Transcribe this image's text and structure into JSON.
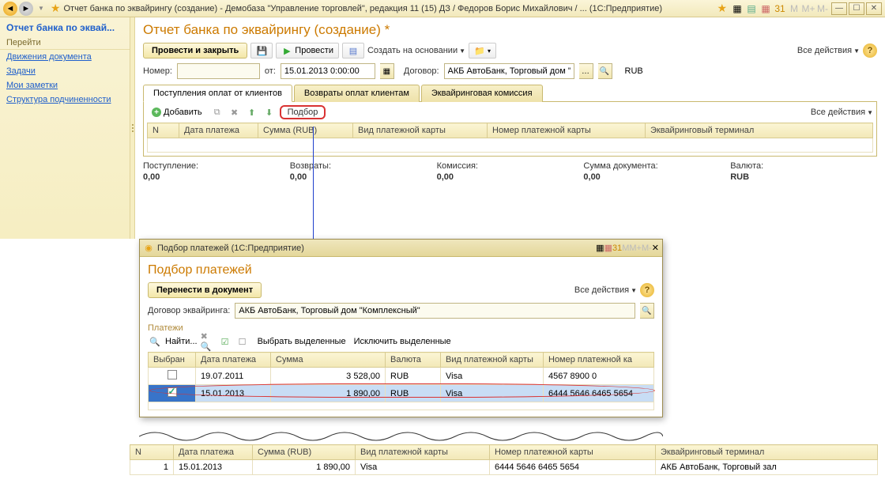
{
  "titlebar": {
    "text": "Отчет банка по эквайрингу (создание) - Демобаза \"Управление торговлей\", редакция 11 (15) ДЗ / Федоров Борис Михайлович / ...   (1С:Предприятие)",
    "m_labels": [
      "M",
      "M+",
      "M-"
    ]
  },
  "sidebar": {
    "title": "Отчет банка по эквай...",
    "section": "Перейти",
    "links": [
      "Движения документа",
      "Задачи",
      "Мои заметки",
      "Структура подчиненности"
    ]
  },
  "form": {
    "title": "Отчет банка по эквайрингу (создание) *",
    "btn_post_close": "Провести и закрыть",
    "btn_post": "Провести",
    "btn_basedon": "Создать на основании",
    "all_actions": "Все действия",
    "lbl_number": "Номер:",
    "number": "",
    "lbl_date": "от:",
    "date": "15.01.2013 0:00:00",
    "lbl_contract": "Договор:",
    "contract": "АКБ АвтоБанк, Торговый дом \"К",
    "currency": "RUB",
    "tabs": [
      "Поступления оплат от клиентов",
      "Возвраты оплат клиентам",
      "Эквайринговая комиссия"
    ],
    "add": "Добавить",
    "podbor": "Подбор",
    "grid_headers": [
      "N",
      "Дата платежа",
      "Сумма (RUB)",
      "Вид платежной карты",
      "Номер платежной карты",
      "Эквайринговый терминал"
    ],
    "totals": {
      "in_l": "Поступление:",
      "in_v": "0,00",
      "ret_l": "Возвраты:",
      "ret_v": "0,00",
      "com_l": "Комиссия:",
      "com_v": "0,00",
      "sum_l": "Сумма документа:",
      "sum_v": "0,00",
      "cur_l": "Валюта:",
      "cur_v": "RUB"
    }
  },
  "popup": {
    "wintitle": "Подбор платежей  (1С:Предприятие)",
    "header": "Подбор платежей",
    "btn_transfer": "Перенести в документ",
    "all_actions": "Все действия",
    "lbl_contract": "Договор эквайринга:",
    "contract": "АКБ АвтоБанк, Торговый дом \"Комплексный\"",
    "group": "Платежи",
    "find": "Найти...",
    "select_marked": "Выбрать выделенные",
    "exclude_marked": "Исключить выделенные",
    "headers": [
      "Выбран",
      "Дата платежа",
      "Сумма",
      "Валюта",
      "Вид платежной карты",
      "Номер платежной ка"
    ],
    "rows": [
      {
        "checked": false,
        "date": "19.07.2011",
        "sum": "3 528,00",
        "cur": "RUB",
        "card": "Visa",
        "num": "4567 8900 0"
      },
      {
        "checked": true,
        "date": "15.01.2013",
        "sum": "1 890,00",
        "cur": "RUB",
        "card": "Visa",
        "num": "6444 5646 6465 5654"
      }
    ],
    "m_labels": [
      "M",
      "M+",
      "M-"
    ]
  },
  "bottom": {
    "headers": [
      "N",
      "Дата платежа",
      "Сумма (RUB)",
      "Вид платежной карты",
      "Номер платежной карты",
      "Эквайринговый терминал"
    ],
    "row": {
      "n": "1",
      "date": "15.01.2013",
      "sum": "1 890,00",
      "card": "Visa",
      "num": "6444 5646 6465 5654",
      "term": "АКБ АвтоБанк, Торговый зал"
    }
  }
}
